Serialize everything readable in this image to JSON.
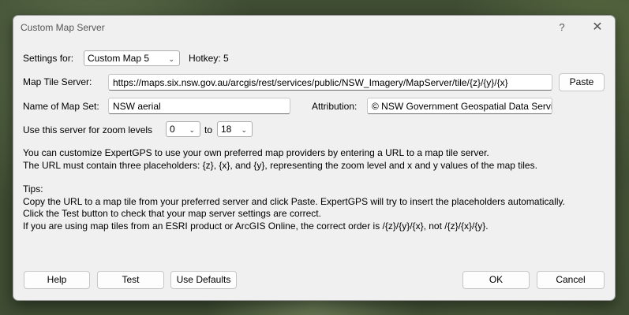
{
  "dialog": {
    "title": "Custom Map Server",
    "help_glyph": "?",
    "close_glyph": "✕"
  },
  "settings": {
    "label": "Settings for:",
    "selected_map": "Custom Map 5",
    "hotkey": "Hotkey: 5"
  },
  "tile_server": {
    "label": "Map Tile Server:",
    "value": "https://maps.six.nsw.gov.au/arcgis/rest/services/public/NSW_Imagery/MapServer/tile/{z}/{y}/{x}",
    "paste_label": "Paste"
  },
  "map_set": {
    "label": "Name of Map Set:",
    "value": "NSW aerial"
  },
  "attribution": {
    "label": "Attribution:",
    "value": "© NSW Government Geospatial Data Services"
  },
  "zoom": {
    "label": "Use this server for zoom levels",
    "min": "0",
    "to_label": "to",
    "max": "18"
  },
  "info": {
    "line1": "You can customize ExpertGPS to use your own preferred map providers by entering a URL to a map tile server.",
    "line2": "The URL must contain three placeholders: {z}, {x}, and {y}, representing the zoom level and x and y values of the map tiles.",
    "tips_heading": "Tips:",
    "tip1": "Copy the URL to a map tile from your preferred server and click Paste. ExpertGPS will try to insert the placeholders automatically.",
    "tip2": "Click the Test button to check that your map server settings are correct.",
    "tip3": "If you are using map tiles from an ESRI product or ArcGIS Online, the correct order is /{z}/{y}/{x}, not /{z}/{x}/{y}."
  },
  "buttons": {
    "help": "Help",
    "test": "Test",
    "use_defaults": "Use Defaults",
    "ok": "OK",
    "cancel": "Cancel"
  },
  "icons": {
    "dropdown": "chevron-down-icon"
  }
}
